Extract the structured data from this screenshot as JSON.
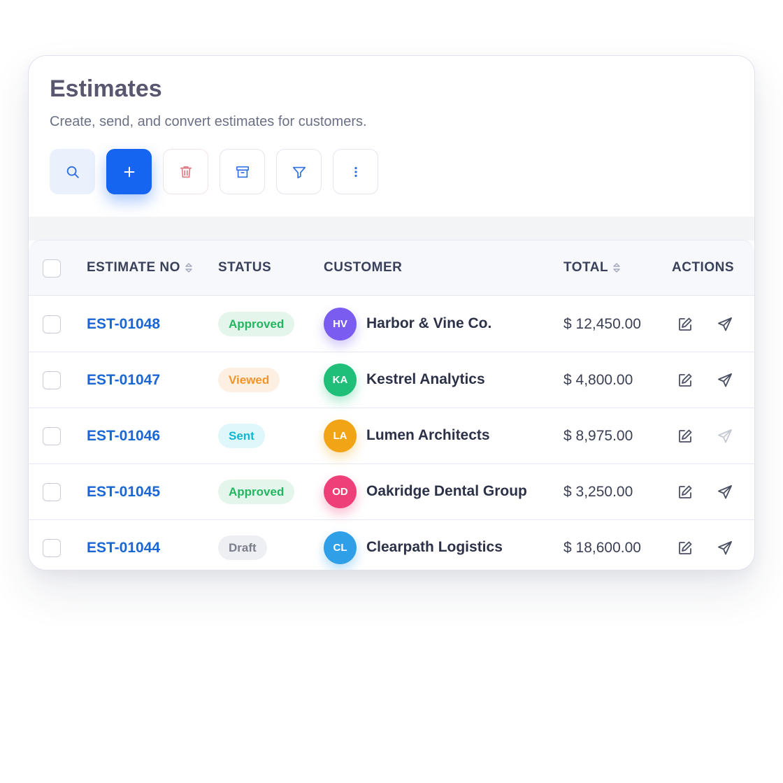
{
  "header": {
    "title": "Estimates",
    "subtitle": "Create, send, and convert estimates for customers."
  },
  "toolbar": {
    "buttons": [
      {
        "name": "search-button",
        "icon": "search-icon"
      },
      {
        "name": "add-button",
        "icon": "plus-icon"
      },
      {
        "name": "delete-button",
        "icon": "trash-icon"
      },
      {
        "name": "archive-button",
        "icon": "archive-icon"
      },
      {
        "name": "filter-button",
        "icon": "filter-icon"
      },
      {
        "name": "more-button",
        "icon": "more-vertical-icon"
      }
    ]
  },
  "table": {
    "columns": {
      "estimate_no": "ESTIMATE NO",
      "status": "STATUS",
      "customer": "CUSTOMER",
      "total": "TOTAL",
      "actions": "ACTIONS"
    },
    "rows": [
      {
        "estimate_no": "EST-01048",
        "status": "Approved",
        "initials": "HV",
        "customer": "Harbor & Vine Co.",
        "total": "$ 12,450.00",
        "send_enabled": true
      },
      {
        "estimate_no": "EST-01047",
        "status": "Viewed",
        "initials": "KA",
        "customer": "Kestrel Analytics",
        "total": "$ 4,800.00",
        "send_enabled": true
      },
      {
        "estimate_no": "EST-01046",
        "status": "Sent",
        "initials": "LA",
        "customer": "Lumen Architects",
        "total": "$ 8,975.00",
        "send_enabled": false
      },
      {
        "estimate_no": "EST-01045",
        "status": "Approved",
        "initials": "OD",
        "customer": "Oakridge Dental Group",
        "total": "$ 3,250.00",
        "send_enabled": true
      },
      {
        "estimate_no": "EST-01044",
        "status": "Draft",
        "initials": "CL",
        "customer": "Clearpath Logistics",
        "total": "$ 18,600.00",
        "send_enabled": true
      }
    ]
  },
  "colors": {
    "primary": "#1565f0",
    "link": "#1a66d6",
    "status": {
      "Approved": {
        "bg": "#e4f6ec",
        "fg": "#22b55f"
      },
      "Viewed": {
        "bg": "#fdf0e2",
        "fg": "#f0952a"
      },
      "Sent": {
        "bg": "#dff7fb",
        "fg": "#12b6d3"
      },
      "Draft": {
        "bg": "#eeeff2",
        "fg": "#7a7e8a"
      }
    },
    "avatars": [
      "#7b5cf0",
      "#1fbf7a",
      "#f0a416",
      "#ef3f78",
      "#2f9fe8"
    ]
  }
}
